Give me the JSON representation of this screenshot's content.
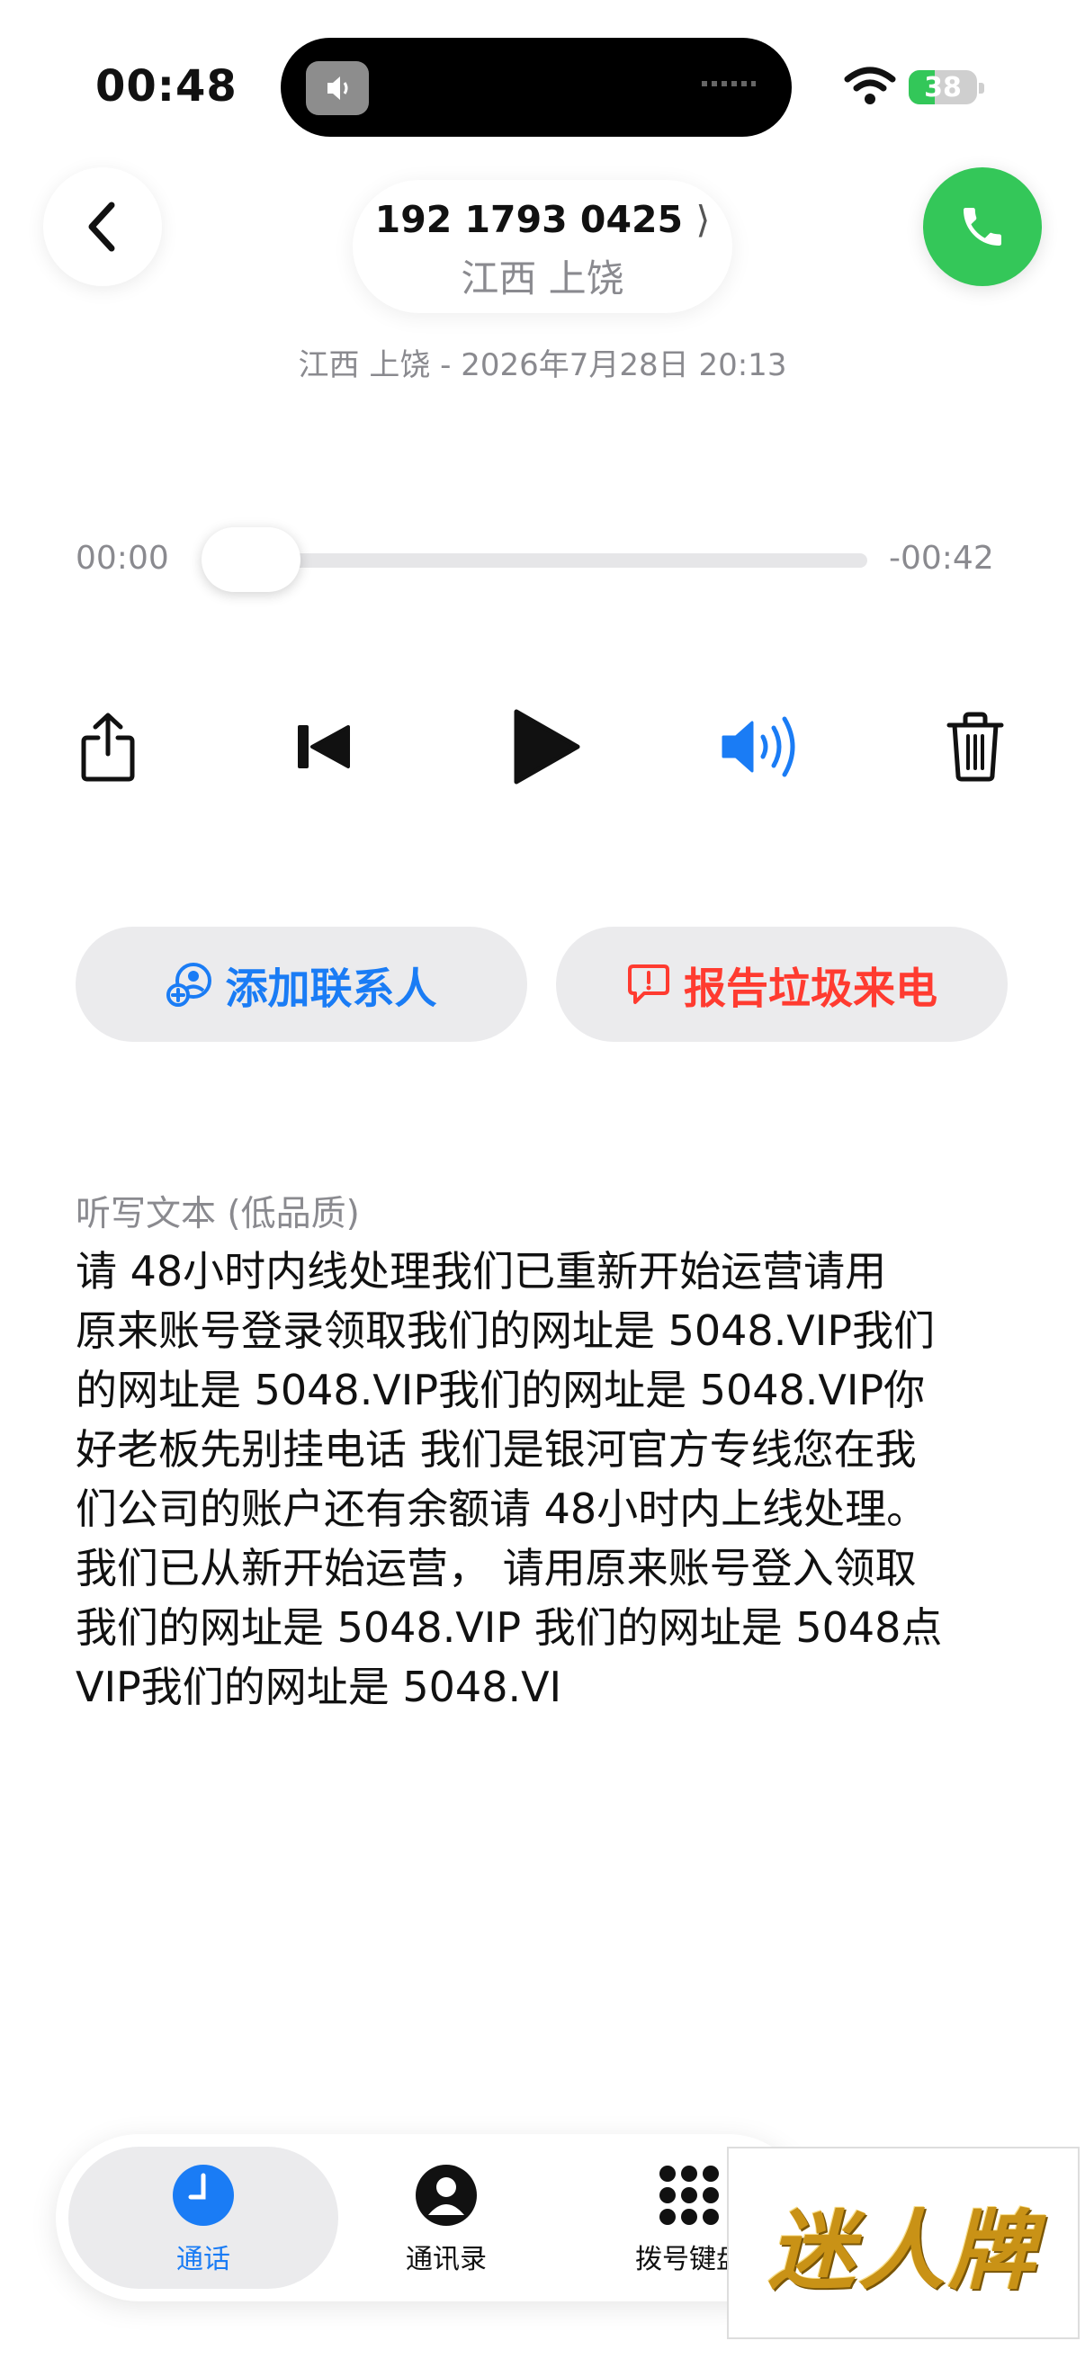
{
  "status_bar": {
    "time": "00:48",
    "battery": "38"
  },
  "header": {
    "phone_number": "192 1793 0425",
    "chevron": "⟩",
    "location": "江西 上饶",
    "subinfo": "江西 上饶 - 2026年7月28日 20:13"
  },
  "player": {
    "elapsed": "00:00",
    "remaining": "-00:42",
    "progress": 0
  },
  "actions": {
    "add_contact": "添加联系人",
    "report_spam": "报告垃圾来电"
  },
  "transcript": {
    "label": "听写文本 (低品质)",
    "text": "请 48小时内线处理我们已重新开始运营请用\n原来账号登录领取我们的网址是 5048.VIP我们\n的网址是 5048.VIP我们的网址是 5048.VIP你\n好老板先别挂电话 我们是银河官方专线您在我\n们公司的账户还有余额请 48小时内上线处理。\n我们已从新开始运营， 请用原来账号登入领取\n我们的网址是 5048.VIP 我们的网址是 5048点\n VIP我们的网址是 5048.VI"
  },
  "tabs": {
    "recents": "通话",
    "contacts": "通讯录",
    "keypad": "拨号键盘"
  },
  "watermark": "迷人牌",
  "colors": {
    "accent": "#1a7cf5",
    "destructive": "#ff3b30",
    "call_green": "#34c759"
  }
}
